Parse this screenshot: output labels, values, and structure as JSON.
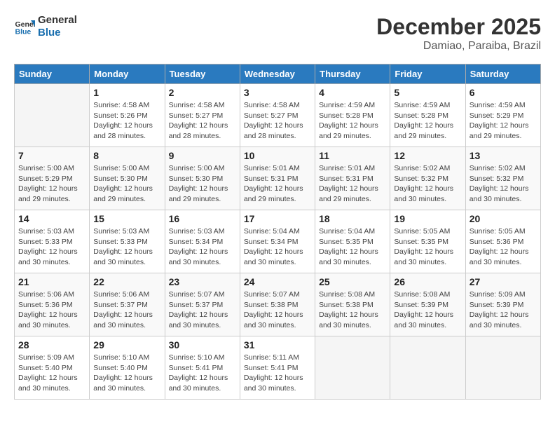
{
  "header": {
    "logo_line1": "General",
    "logo_line2": "Blue",
    "month_year": "December 2025",
    "location": "Damiao, Paraiba, Brazil"
  },
  "days_of_week": [
    "Sunday",
    "Monday",
    "Tuesday",
    "Wednesday",
    "Thursday",
    "Friday",
    "Saturday"
  ],
  "weeks": [
    [
      {
        "day": "",
        "info": ""
      },
      {
        "day": "1",
        "info": "Sunrise: 4:58 AM\nSunset: 5:26 PM\nDaylight: 12 hours\nand 28 minutes."
      },
      {
        "day": "2",
        "info": "Sunrise: 4:58 AM\nSunset: 5:27 PM\nDaylight: 12 hours\nand 28 minutes."
      },
      {
        "day": "3",
        "info": "Sunrise: 4:58 AM\nSunset: 5:27 PM\nDaylight: 12 hours\nand 28 minutes."
      },
      {
        "day": "4",
        "info": "Sunrise: 4:59 AM\nSunset: 5:28 PM\nDaylight: 12 hours\nand 29 minutes."
      },
      {
        "day": "5",
        "info": "Sunrise: 4:59 AM\nSunset: 5:28 PM\nDaylight: 12 hours\nand 29 minutes."
      },
      {
        "day": "6",
        "info": "Sunrise: 4:59 AM\nSunset: 5:29 PM\nDaylight: 12 hours\nand 29 minutes."
      }
    ],
    [
      {
        "day": "7",
        "info": "Sunrise: 5:00 AM\nSunset: 5:29 PM\nDaylight: 12 hours\nand 29 minutes."
      },
      {
        "day": "8",
        "info": "Sunrise: 5:00 AM\nSunset: 5:30 PM\nDaylight: 12 hours\nand 29 minutes."
      },
      {
        "day": "9",
        "info": "Sunrise: 5:00 AM\nSunset: 5:30 PM\nDaylight: 12 hours\nand 29 minutes."
      },
      {
        "day": "10",
        "info": "Sunrise: 5:01 AM\nSunset: 5:31 PM\nDaylight: 12 hours\nand 29 minutes."
      },
      {
        "day": "11",
        "info": "Sunrise: 5:01 AM\nSunset: 5:31 PM\nDaylight: 12 hours\nand 29 minutes."
      },
      {
        "day": "12",
        "info": "Sunrise: 5:02 AM\nSunset: 5:32 PM\nDaylight: 12 hours\nand 30 minutes."
      },
      {
        "day": "13",
        "info": "Sunrise: 5:02 AM\nSunset: 5:32 PM\nDaylight: 12 hours\nand 30 minutes."
      }
    ],
    [
      {
        "day": "14",
        "info": "Sunrise: 5:03 AM\nSunset: 5:33 PM\nDaylight: 12 hours\nand 30 minutes."
      },
      {
        "day": "15",
        "info": "Sunrise: 5:03 AM\nSunset: 5:33 PM\nDaylight: 12 hours\nand 30 minutes."
      },
      {
        "day": "16",
        "info": "Sunrise: 5:03 AM\nSunset: 5:34 PM\nDaylight: 12 hours\nand 30 minutes."
      },
      {
        "day": "17",
        "info": "Sunrise: 5:04 AM\nSunset: 5:34 PM\nDaylight: 12 hours\nand 30 minutes."
      },
      {
        "day": "18",
        "info": "Sunrise: 5:04 AM\nSunset: 5:35 PM\nDaylight: 12 hours\nand 30 minutes."
      },
      {
        "day": "19",
        "info": "Sunrise: 5:05 AM\nSunset: 5:35 PM\nDaylight: 12 hours\nand 30 minutes."
      },
      {
        "day": "20",
        "info": "Sunrise: 5:05 AM\nSunset: 5:36 PM\nDaylight: 12 hours\nand 30 minutes."
      }
    ],
    [
      {
        "day": "21",
        "info": "Sunrise: 5:06 AM\nSunset: 5:36 PM\nDaylight: 12 hours\nand 30 minutes."
      },
      {
        "day": "22",
        "info": "Sunrise: 5:06 AM\nSunset: 5:37 PM\nDaylight: 12 hours\nand 30 minutes."
      },
      {
        "day": "23",
        "info": "Sunrise: 5:07 AM\nSunset: 5:37 PM\nDaylight: 12 hours\nand 30 minutes."
      },
      {
        "day": "24",
        "info": "Sunrise: 5:07 AM\nSunset: 5:38 PM\nDaylight: 12 hours\nand 30 minutes."
      },
      {
        "day": "25",
        "info": "Sunrise: 5:08 AM\nSunset: 5:38 PM\nDaylight: 12 hours\nand 30 minutes."
      },
      {
        "day": "26",
        "info": "Sunrise: 5:08 AM\nSunset: 5:39 PM\nDaylight: 12 hours\nand 30 minutes."
      },
      {
        "day": "27",
        "info": "Sunrise: 5:09 AM\nSunset: 5:39 PM\nDaylight: 12 hours\nand 30 minutes."
      }
    ],
    [
      {
        "day": "28",
        "info": "Sunrise: 5:09 AM\nSunset: 5:40 PM\nDaylight: 12 hours\nand 30 minutes."
      },
      {
        "day": "29",
        "info": "Sunrise: 5:10 AM\nSunset: 5:40 PM\nDaylight: 12 hours\nand 30 minutes."
      },
      {
        "day": "30",
        "info": "Sunrise: 5:10 AM\nSunset: 5:41 PM\nDaylight: 12 hours\nand 30 minutes."
      },
      {
        "day": "31",
        "info": "Sunrise: 5:11 AM\nSunset: 5:41 PM\nDaylight: 12 hours\nand 30 minutes."
      },
      {
        "day": "",
        "info": ""
      },
      {
        "day": "",
        "info": ""
      },
      {
        "day": "",
        "info": ""
      }
    ]
  ]
}
